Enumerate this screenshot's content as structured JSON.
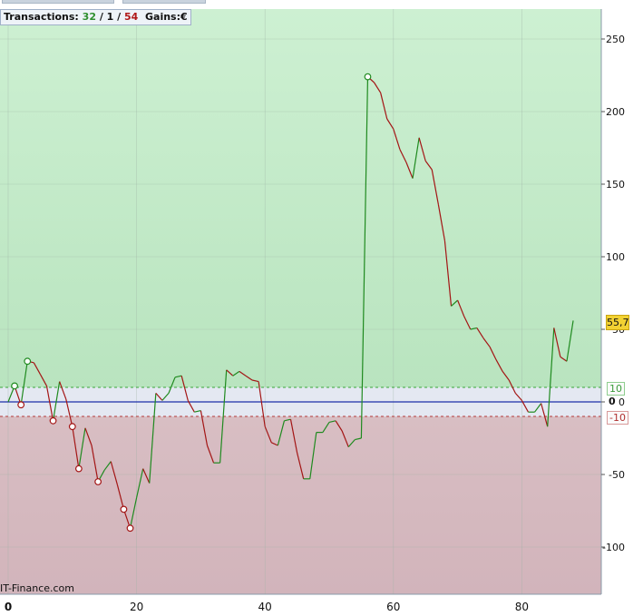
{
  "header": {
    "prefix": "Transactions:",
    "wins": "32",
    "sep1": " / ",
    "neutral": "1",
    "sep2": " / ",
    "losses": "54",
    "gains_label": "Gains:",
    "currency": "€"
  },
  "watermark": "IT-Finance.com",
  "last_value_label": "55,7",
  "band_upper_label": "10",
  "band_lower_label": "-10",
  "zero_label": "0",
  "colors": {
    "profit_zone": "#b9e4bf",
    "loss_zone": "#d2b4bb",
    "neutral_band": "#e4e8f2",
    "up_segment": "#1f8a1f",
    "down_segment": "#a31515",
    "zero_line": "#1c2fa8",
    "band_line_upper": "#3aa63a",
    "band_line_lower": "#b33a3a",
    "badge": "#f2d233"
  },
  "chart_data": {
    "type": "line",
    "title": "",
    "xlabel": "",
    "ylabel": "",
    "x_ticks": [
      0,
      20,
      40,
      60,
      80
    ],
    "y_ticks": [
      -100,
      -50,
      0,
      50,
      100,
      150,
      200,
      250
    ],
    "xlim": [
      0,
      92
    ],
    "ylim": [
      -133,
      272
    ],
    "grid": true,
    "band": [
      -10,
      10
    ],
    "last_value": 55.7,
    "series": [
      {
        "values": [
          0,
          11,
          -2,
          28,
          27,
          19,
          11,
          -13,
          14,
          2,
          -17,
          -46,
          -18,
          -30,
          -55,
          -47,
          -41,
          -57,
          -74,
          -87,
          -66,
          -46,
          -56,
          6,
          1,
          6,
          17,
          18,
          1,
          -7,
          -6,
          -30,
          -42,
          -42,
          22,
          18,
          21,
          18,
          15,
          14,
          -17,
          -28,
          -30,
          -13,
          -12,
          -35,
          -53,
          -53,
          -21,
          -21,
          -14,
          -13,
          -20,
          -31,
          -26,
          -25,
          224,
          220,
          213,
          195,
          188,
          174,
          165,
          154,
          182,
          166,
          160,
          136,
          111,
          66,
          70,
          59,
          50,
          51,
          44,
          38,
          29,
          21,
          15,
          6,
          1,
          -7,
          -7,
          -1,
          -17,
          51,
          31,
          28,
          56
        ]
      }
    ],
    "markers": [
      {
        "x": 1,
        "y": 11,
        "kind": "win"
      },
      {
        "x": 2,
        "y": -2,
        "kind": "loss"
      },
      {
        "x": 3,
        "y": 28,
        "kind": "win"
      },
      {
        "x": 7,
        "y": -13,
        "kind": "loss"
      },
      {
        "x": 10,
        "y": -17,
        "kind": "loss"
      },
      {
        "x": 11,
        "y": -46,
        "kind": "loss"
      },
      {
        "x": 14,
        "y": -55,
        "kind": "loss"
      },
      {
        "x": 18,
        "y": -74,
        "kind": "loss"
      },
      {
        "x": 19,
        "y": -87,
        "kind": "loss"
      },
      {
        "x": 56,
        "y": 224,
        "kind": "win"
      }
    ]
  }
}
